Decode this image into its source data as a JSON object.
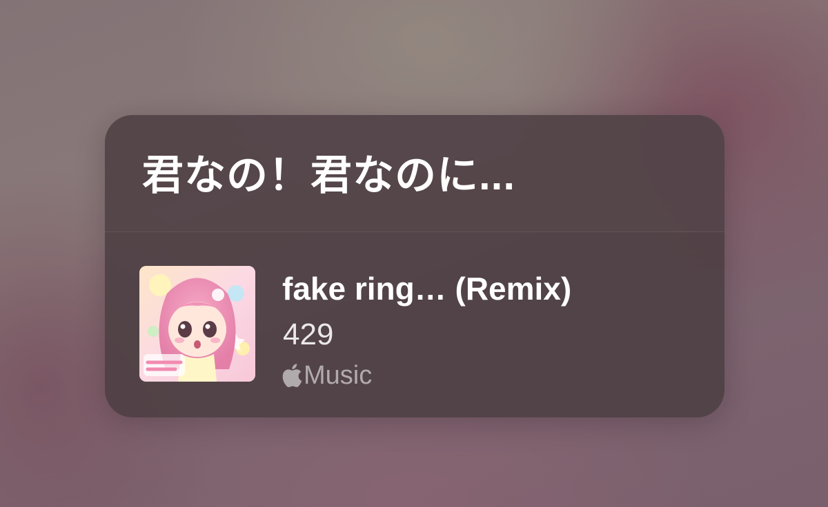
{
  "lyric_card": {
    "lyric_line": "君なの！君なのに..."
  },
  "track": {
    "title": "fake ring… (Remix)",
    "subtitle": "429",
    "service_label": "Music",
    "service_icon": "apple-logo-icon",
    "artwork_icon": "album-artwork"
  },
  "colors": {
    "card_background": "#4e4044",
    "primary_text": "#ffffff",
    "secondary_text": "#a89fa2"
  }
}
